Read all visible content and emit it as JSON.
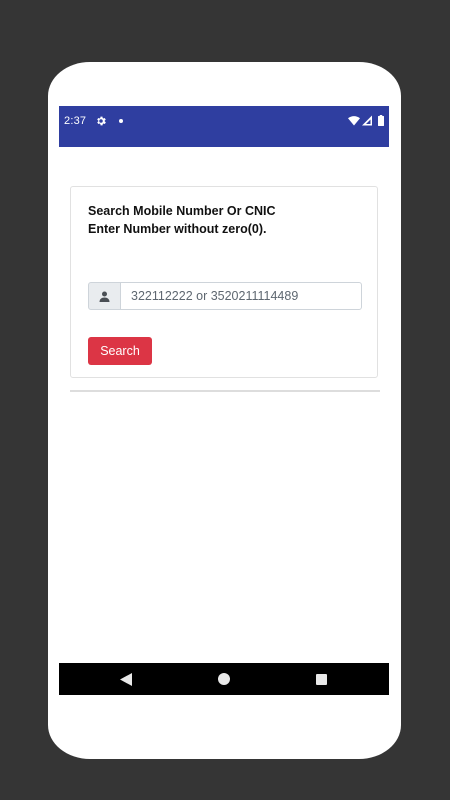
{
  "status_bar": {
    "time": "2:37",
    "icons": [
      "settings-icon",
      "notification-dot-icon",
      "wifi-icon",
      "signal-icon",
      "battery-icon"
    ],
    "background_color": "#2f3ea0"
  },
  "search_card": {
    "title_line1": "Search Mobile Number Or CNIC",
    "title_line2": "Enter Number without zero(0).",
    "input": {
      "addon_icon": "user-icon",
      "value": "",
      "placeholder": "322112222 or 3520211114489"
    },
    "search_button_label": "Search",
    "button_color": "#dc3545"
  },
  "nav_bar": {
    "icons": [
      "back-icon",
      "home-icon",
      "recents-icon"
    ]
  }
}
